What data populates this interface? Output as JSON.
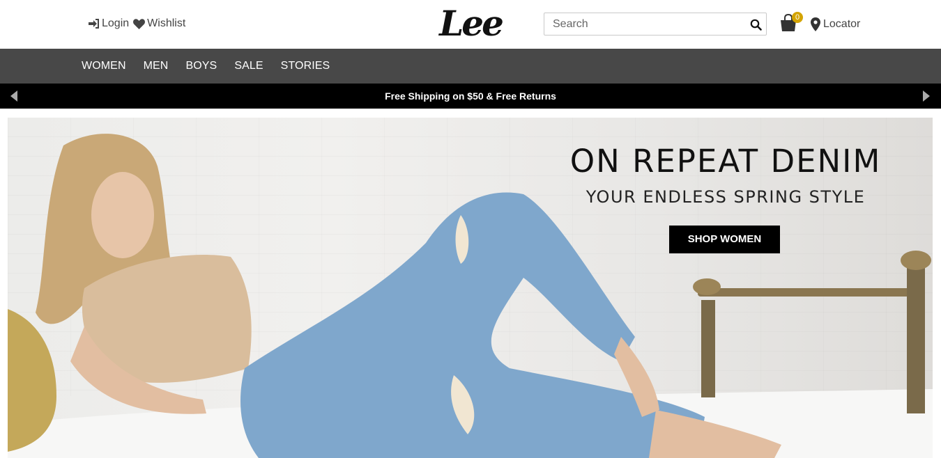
{
  "header": {
    "login_label": "Login",
    "wishlist_label": "Wishlist",
    "logo_text": "Lee",
    "search_placeholder": "Search",
    "cart_count": "0",
    "locator_label": "Locator"
  },
  "nav": {
    "items": [
      {
        "label": "WOMEN"
      },
      {
        "label": "MEN"
      },
      {
        "label": "BOYS"
      },
      {
        "label": "SALE"
      },
      {
        "label": "STORIES"
      }
    ]
  },
  "promo": {
    "text": "Free Shipping on $50  &  Free Returns"
  },
  "hero": {
    "title": "ON REPEAT DENIM",
    "subtitle": "YOUR ENDLESS SPRING STYLE",
    "cta_label": "SHOP WOMEN"
  },
  "icons": {
    "login": "sign-in-icon",
    "wishlist": "heart-icon",
    "search": "search-icon",
    "cart": "shopping-bag-icon",
    "locator": "map-marker-icon",
    "promo_prev": "chevron-left-icon",
    "promo_next": "chevron-right-icon"
  },
  "colors": {
    "nav_bg": "#484848",
    "promo_bg": "#000000",
    "cart_badge": "#d4a400",
    "denim": "#7fa7cc"
  }
}
